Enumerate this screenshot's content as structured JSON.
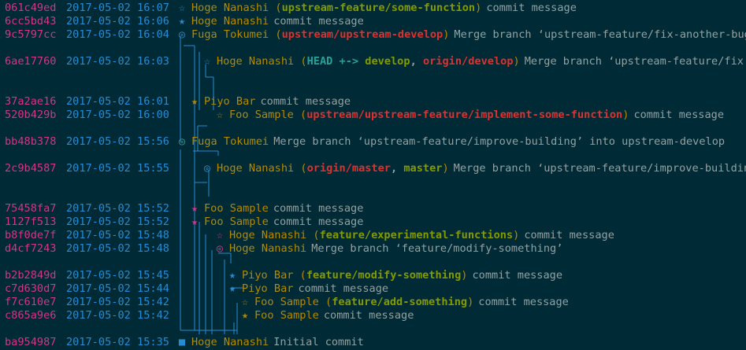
{
  "commits": [
    {
      "hash": "061c49ed",
      "date": "2017-05-02 16:07",
      "marker": "☆",
      "marker_color": "#268bd2",
      "author": "Hoge Nanashi",
      "refs_prefix": " (",
      "refs": [
        {
          "text": "upstream-feature/some-function",
          "color": "#859900"
        }
      ],
      "refs_suffix": ")",
      "message": "commit message"
    },
    {
      "hash": "6cc5bd43",
      "date": "2017-05-02 16:06",
      "marker": "★",
      "marker_color": "#268bd2",
      "author": "Hoge Nanashi",
      "refs_prefix": "",
      "refs": [],
      "refs_suffix": "",
      "message": "commit message"
    },
    {
      "hash": "9c5797cc",
      "date": "2017-05-02 16:04",
      "marker": "◎",
      "marker_color": "#268bd2",
      "author": "Fuga Tokumei",
      "refs_prefix": " (",
      "refs": [
        {
          "text": "upstream/upstream-develop",
          "color": "#dc322f"
        }
      ],
      "refs_suffix": ")",
      "message": "Merge branch ‘upstream-feature/fix-another-bug’"
    },
    {
      "hash": "6ae17760",
      "date": "2017-05-02 16:03",
      "marker": "☆",
      "marker_color": "#268bd2",
      "author": "Hoge Nanashi",
      "refs_prefix": " (",
      "refs": [
        {
          "text": "HEAD",
          "color": "#2aa198"
        },
        {
          "text": " +-> ",
          "color": "#2aa198"
        },
        {
          "text": "develop",
          "color": "#859900"
        },
        {
          "text": ", ",
          "color": "#93a1a1"
        },
        {
          "text": "origin/develop",
          "color": "#dc322f"
        }
      ],
      "refs_suffix": ")",
      "message": "Merge branch ‘upstream-feature/fix"
    },
    {
      "hash": "37a2ae16",
      "date": "2017-05-02 16:01",
      "marker": "★",
      "marker_color": "#b58900",
      "author": "Piyo Bar",
      "refs_prefix": "",
      "refs": [],
      "refs_suffix": "",
      "message": "commit message"
    },
    {
      "hash": "520b429b",
      "date": "2017-05-02 16:00",
      "marker": "☆",
      "marker_color": "#b58900",
      "author": "Foo Sample",
      "refs_prefix": " (",
      "refs": [
        {
          "text": "upstream/upstream-feature/implement-some-function",
          "color": "#dc322f"
        }
      ],
      "refs_suffix": ")",
      "message": "commit message"
    },
    {
      "hash": "bb48b378",
      "date": "2017-05-02 15:56",
      "marker": "◎",
      "marker_color": "#2aa198",
      "author": "Fuga Tokumei",
      "refs_prefix": "",
      "refs": [],
      "refs_suffix": "",
      "message": "Merge branch ‘upstream-feature/improve-building’ into upstream-develop"
    },
    {
      "hash": "2c9b4587",
      "date": "2017-05-02 15:55",
      "marker": "◎",
      "marker_color": "#268bd2",
      "author": "Hoge Nanashi",
      "refs_prefix": " (",
      "refs": [
        {
          "text": "origin/master",
          "color": "#dc322f"
        },
        {
          "text": ", ",
          "color": "#93a1a1"
        },
        {
          "text": "master",
          "color": "#859900"
        }
      ],
      "refs_suffix": ")",
      "message": "Merge branch ‘upstream-feature/improve-building"
    },
    {
      "hash": "75458fa7",
      "date": "2017-05-02 15:52",
      "marker": "★",
      "marker_color": "#d33682",
      "author": "Foo Sample",
      "refs_prefix": "",
      "refs": [],
      "refs_suffix": "",
      "message": "commit message"
    },
    {
      "hash": "1127f513",
      "date": "2017-05-02 15:52",
      "marker": "★",
      "marker_color": "#d33682",
      "author": "Foo Sample",
      "refs_prefix": "",
      "refs": [],
      "refs_suffix": "",
      "message": "commit message"
    },
    {
      "hash": "b8f0de7f",
      "date": "2017-05-02 15:48",
      "marker": "☆",
      "marker_color": "#d33682",
      "author": "Hoge Nanashi",
      "refs_prefix": " (",
      "refs": [
        {
          "text": "feature/experimental-functions",
          "color": "#859900"
        }
      ],
      "refs_suffix": ")",
      "message": "commit message"
    },
    {
      "hash": "d4cf7243",
      "date": "2017-05-02 15:48",
      "marker": "◎",
      "marker_color": "#d33682",
      "author": "Hoge Nanashi",
      "refs_prefix": "",
      "refs": [],
      "refs_suffix": "",
      "message": "Merge branch ‘feature/modify-something’"
    },
    {
      "hash": "b2b2849d",
      "date": "2017-05-02 15:45",
      "marker": "★",
      "marker_color": "#268bd2",
      "author": "Piyo Bar",
      "refs_prefix": " (",
      "refs": [
        {
          "text": "feature/modify-something",
          "color": "#859900"
        }
      ],
      "refs_suffix": ")",
      "message": "commit message"
    },
    {
      "hash": "c7d630d7",
      "date": "2017-05-02 15:44",
      "marker": "★",
      "marker_color": "#268bd2",
      "author": "Piyo Bar",
      "refs_prefix": "",
      "refs": [],
      "refs_suffix": "",
      "message": "commit message"
    },
    {
      "hash": "f7c610e7",
      "date": "2017-05-02 15:42",
      "marker": "☆",
      "marker_color": "#b58900",
      "author": "Foo Sample",
      "refs_prefix": " (",
      "refs": [
        {
          "text": "feature/add-something",
          "color": "#859900"
        }
      ],
      "refs_suffix": ")",
      "message": "commit message"
    },
    {
      "hash": "c865a9e6",
      "date": "2017-05-02 15:42",
      "marker": "★",
      "marker_color": "#b58900",
      "author": "Foo Sample",
      "refs_prefix": "",
      "refs": [],
      "refs_suffix": "",
      "message": "commit message"
    },
    {
      "hash": "ba954987",
      "date": "2017-05-02 15:35",
      "marker": "■",
      "marker_color": "#268bd2",
      "author": "Hoge Nanashi",
      "refs_prefix": "",
      "refs": [],
      "refs_suffix": "",
      "message": "Initial commit"
    }
  ],
  "colors": {
    "background": "#002b36",
    "hash": "#d33682",
    "date": "#268bd2",
    "author": "#b58900",
    "text": "#93a1a1",
    "graph_line": "#268bd2"
  }
}
